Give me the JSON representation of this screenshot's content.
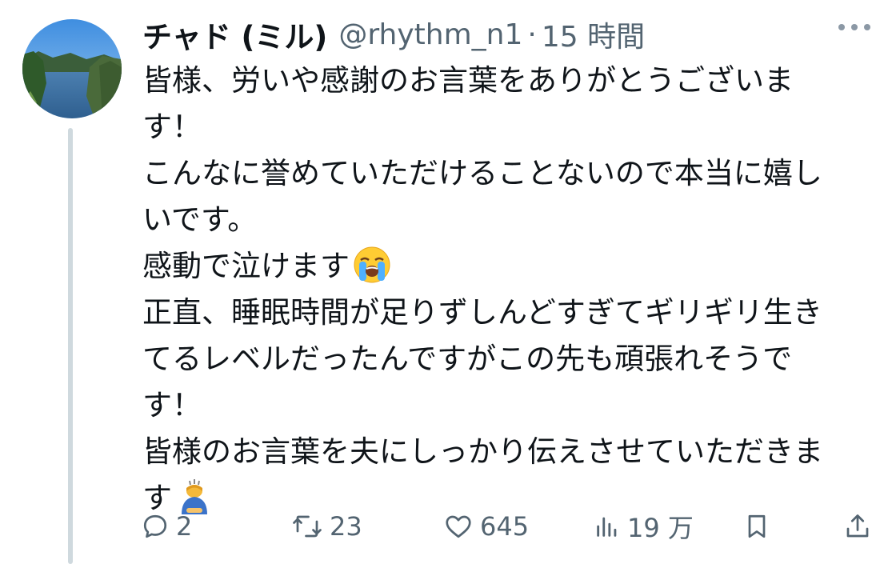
{
  "tweet": {
    "display_name": "チャド (ミル)",
    "handle": "@rhythm_n1",
    "separator": "·",
    "time": "15 時間",
    "lines": [
      "皆様、労いや感謝のお言葉をありがとうございま",
      "す！",
      "こんなに誉めていただけることないので本当に嬉し",
      "いです。",
      "感動で泣けます",
      "正直、睡眠時間が足りずしんどすぎてギリギリ生き",
      "てるレベルだったんですがこの先も頑張れそうで",
      "す！",
      "皆様のお言葉を夫にしっかり伝えさせていただきま",
      "す"
    ],
    "emoji_after_line_4": "loudly-crying-face",
    "emoji_after_line_9": "person-bowing"
  },
  "actions": {
    "reply_count": "2",
    "retweet_count": "23",
    "like_count": "645",
    "views_count": "19 万"
  },
  "icons": {
    "reply": "reply-icon",
    "retweet": "retweet-icon",
    "like": "heart-icon",
    "views": "views-icon",
    "bookmark": "bookmark-icon",
    "share": "share-icon",
    "more": "more-icon"
  },
  "colors": {
    "text": "#0f1419",
    "secondary": "#536471",
    "thread_line": "#cfd9de"
  }
}
